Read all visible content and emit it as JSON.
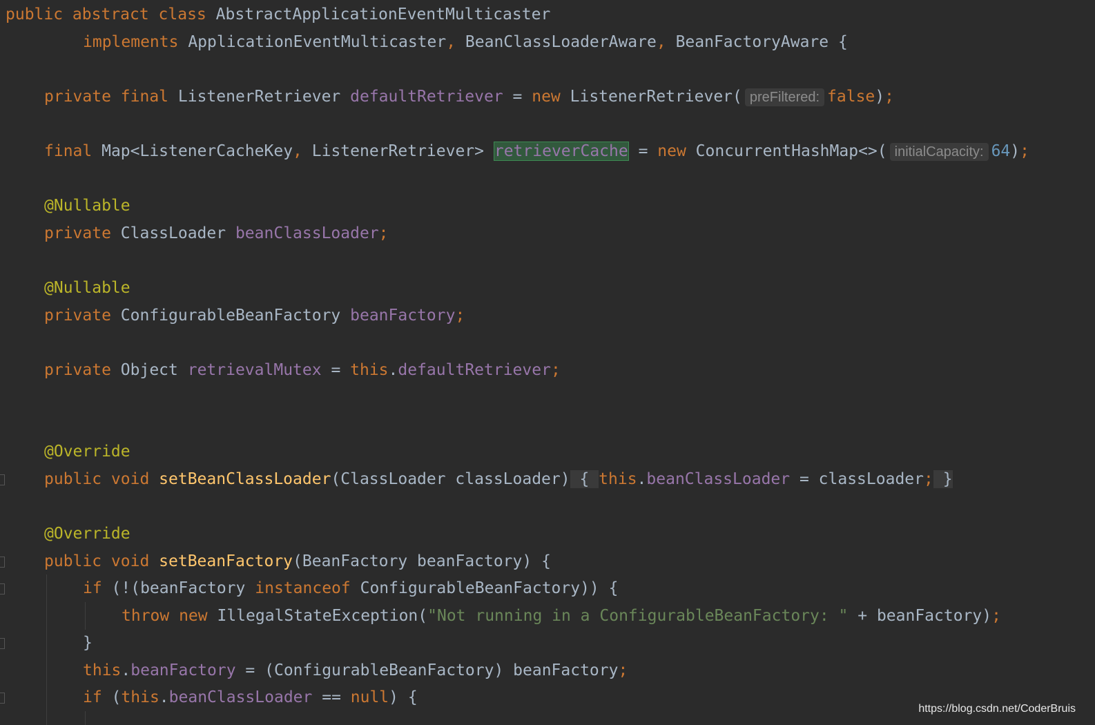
{
  "editor": {
    "lines": {
      "l1": {
        "kw": "public abstract class ",
        "name": "AbstractApplicationEventMulticaster"
      },
      "l2": {
        "kw": "implements ",
        "i1": "ApplicationEventMulticaster",
        "c1": ", ",
        "i2": "BeanClassLoaderAware",
        "c2": ", ",
        "i3": "BeanFactoryAware",
        "end": " {"
      },
      "l4": {
        "kw1": "private final ",
        "type": "ListenerRetriever ",
        "field": "defaultRetriever",
        "eq": " = ",
        "kw2": "new ",
        "ctor": "ListenerRetriever(",
        "hint": "preFiltered:",
        "val": "false",
        "end1": ")",
        "end2": ";"
      },
      "l6": {
        "kw": "final ",
        "type": "Map<ListenerCacheKey",
        "comma": ", ",
        "type2": "ListenerRetriever> ",
        "field": "retrieverCache",
        "eq": " = ",
        "kw2": "new ",
        "ctor": "ConcurrentHashMap<>(",
        "hint": "initialCapacity:",
        "num": "64",
        "end1": ")",
        "end2": ";"
      },
      "l8": {
        "ann": "@Nullable"
      },
      "l9": {
        "kw": "private ",
        "type": "ClassLoader ",
        "field": "beanClassLoader",
        "end": ";"
      },
      "l11": {
        "ann": "@Nullable"
      },
      "l12": {
        "kw": "private ",
        "type": "ConfigurableBeanFactory ",
        "field": "beanFactory",
        "end": ";"
      },
      "l14": {
        "kw": "private ",
        "type": "Object ",
        "field": "retrievalMutex",
        "eq": " = ",
        "kw2": "this",
        "dot": ".",
        "field2": "defaultRetriever",
        "end": ";"
      },
      "l17": {
        "ann": "@Override"
      },
      "l18": {
        "kw": "public void ",
        "fn": "setBeanClassLoader",
        "params": "(ClassLoader classLoader)",
        "ob": " { ",
        "kw2": "this",
        "dot": ".",
        "field": "beanClassLoader",
        "rest": " = classLoader",
        "semi": ";",
        "cb": " }"
      },
      "l20": {
        "ann": "@Override"
      },
      "l21": {
        "kw": "public void ",
        "fn": "setBeanFactory",
        "params": "(BeanFactory beanFactory) {"
      },
      "l22": {
        "kw": "if ",
        "p1": "(!(beanFactory ",
        "kw2": "instanceof ",
        "p2": "ConfigurableBeanFactory)) {"
      },
      "l23": {
        "kw": "throw new ",
        "ctor": "IllegalStateException(",
        "str": "\"Not running in a ConfigurableBeanFactory: \"",
        "rest": " + beanFactory)",
        "semi": ";"
      },
      "l24": {
        "brace": "}"
      },
      "l25": {
        "kw": "this",
        "dot": ".",
        "field": "beanFactory",
        "rest": " = (ConfigurableBeanFactory) beanFactory",
        "semi": ";"
      },
      "l26": {
        "kw": "if ",
        "p1": "(",
        "kw2": "this",
        "dot": ".",
        "field": "beanClassLoader",
        "p2": " == ",
        "kw3": "null",
        "p3": ") {"
      }
    }
  },
  "watermark": "https://blog.csdn.net/CoderBruis"
}
